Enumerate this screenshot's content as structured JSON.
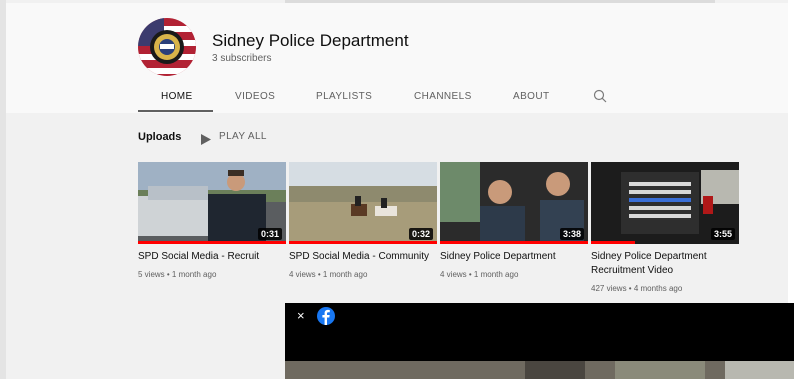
{
  "channel": {
    "name": "Sidney Police Department",
    "subscribers": "3 subscribers"
  },
  "tabs": [
    {
      "label": "HOME",
      "active": true
    },
    {
      "label": "VIDEOS"
    },
    {
      "label": "PLAYLISTS"
    },
    {
      "label": "CHANNELS"
    },
    {
      "label": "ABOUT"
    }
  ],
  "uploads": {
    "title": "Uploads",
    "play_all": "PLAY ALL"
  },
  "videos": [
    {
      "title": "SPD Social Media - Recruit",
      "meta": "5 views • 1 month ago",
      "duration": "0:31",
      "progress": 1.0
    },
    {
      "title": "SPD Social Media - Community",
      "meta": "4 views • 1 month ago",
      "duration": "0:32",
      "progress": 1.0
    },
    {
      "title": "Sidney Police Department",
      "meta": "4 views • 1 month ago",
      "duration": "3:38",
      "progress": 1.0
    },
    {
      "title": "Sidney Police Department Recruitment Video",
      "meta": "427 views • 4 months ago",
      "duration": "3:55",
      "progress": 0.3
    }
  ],
  "overlay": {
    "close": "×"
  },
  "colors": {
    "progress": "#ff0000",
    "facebook": "#1877f2"
  }
}
